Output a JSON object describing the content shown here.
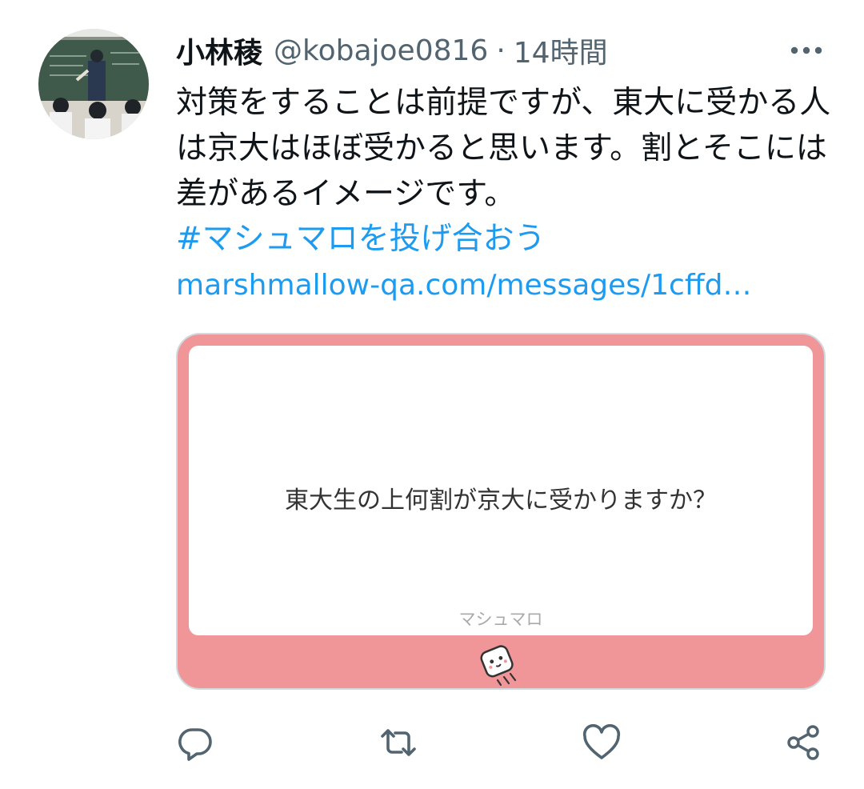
{
  "user": {
    "display_name": "小林稜",
    "handle": "@kobajoe0816",
    "separator": "·",
    "time": "14時間"
  },
  "tweet": {
    "text": "対策をすることは前提ですが、東大に受かる人は京大はほぼ受かると思います。割とそこには差があるイメージです。",
    "hashtag": "#マシュマロを投げ合おう",
    "link": "marshmallow-qa.com/messages/1cffd…"
  },
  "card": {
    "question": "東大生の上何割が京大に受かりますか？",
    "brand": "マシュマロ"
  },
  "icons": {
    "more": "more-icon",
    "reply": "reply-icon",
    "retweet": "retweet-icon",
    "like": "like-icon",
    "share": "share-icon"
  },
  "colors": {
    "accent": "#1d9bf0",
    "card_background": "#f09698",
    "text_primary": "#0f1419",
    "text_secondary": "#536471"
  }
}
